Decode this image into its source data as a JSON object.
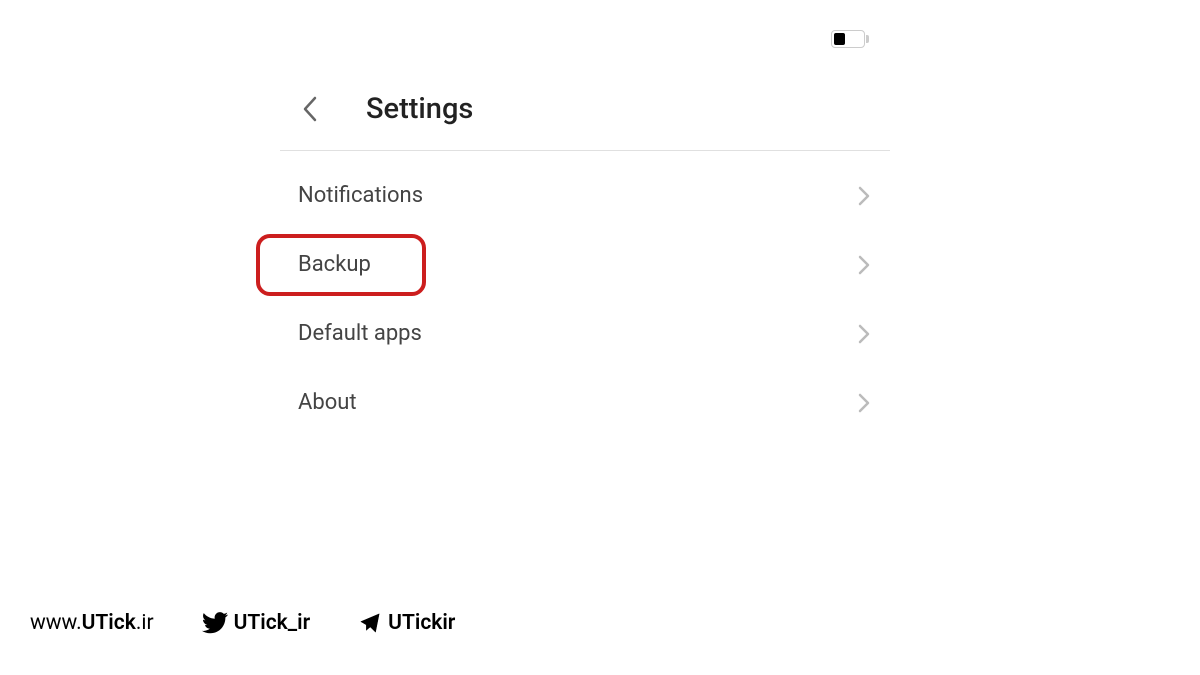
{
  "header": {
    "title": "Settings"
  },
  "menu": {
    "items": [
      {
        "label": "Notifications",
        "highlighted": false
      },
      {
        "label": "Backup",
        "highlighted": true
      },
      {
        "label": "Default apps",
        "highlighted": false
      },
      {
        "label": "About",
        "highlighted": false
      }
    ]
  },
  "footer": {
    "website_prefix": "www.",
    "website_main": "UTick",
    "website_suffix": ".ir",
    "twitter_handle": "UTick_ir",
    "telegram_handle": "UTickir"
  }
}
